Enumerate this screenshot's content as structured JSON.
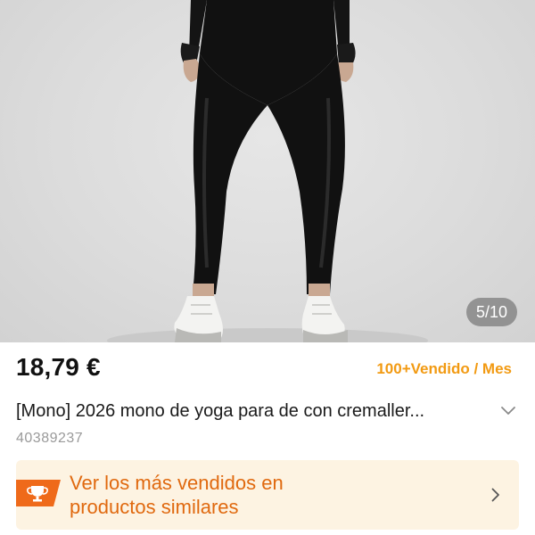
{
  "gallery": {
    "counter": "5/10"
  },
  "product": {
    "price": "18,79 €",
    "sold": "100+Vendido / Mes",
    "title": "[Mono] 2026 mono de yoga para de con cremaller...",
    "sku": "40389237"
  },
  "banner": {
    "text": "Ver los más vendidos en productos similares",
    "icon": "trophy-icon"
  },
  "colors": {
    "accent": "#f29a12",
    "banner_bg": "#fdf3e2",
    "banner_text": "#e0690f",
    "icon_bg": "#ef6a1a"
  }
}
